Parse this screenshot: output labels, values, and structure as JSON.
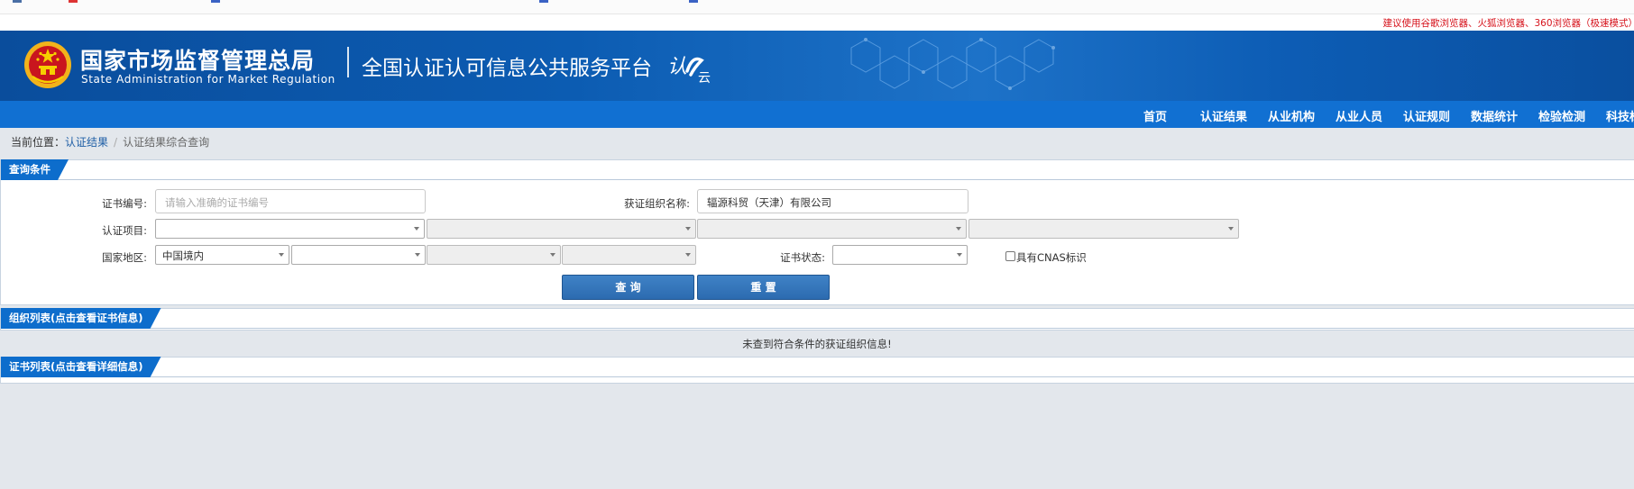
{
  "notice": {
    "text": "建议使用谷歌浏览器、火狐浏览器、360浏览器（极速模式）"
  },
  "header": {
    "org_cn": "国家市场监督管理总局",
    "org_en": "State Administration  for  Market Regulation",
    "platform_title": "全国认证认可信息公共服务平台",
    "logo_mark": "认证云",
    "emblem_icon": "national-emblem-icon"
  },
  "nav": {
    "items": [
      "首页",
      "认证结果",
      "从业机构",
      "从业人员",
      "认证规则",
      "数据统计",
      "检验检测",
      "科技标准"
    ]
  },
  "breadcrumb": {
    "prefix": "当前位置：",
    "link": "认证结果",
    "separator": "/",
    "current": "认证结果综合查询"
  },
  "query": {
    "tab_title": "查询条件",
    "cert_no": {
      "label": "证书编号:",
      "placeholder": "请输入准确的证书编号"
    },
    "org_name": {
      "label": "获证组织名称:",
      "value": "辐源科贸（天津）有限公司"
    },
    "cert_project": {
      "label": "认证项目:"
    },
    "region": {
      "label": "国家地区:",
      "selected": "中国境内"
    },
    "cert_status": {
      "label": "证书状态:"
    },
    "cnas": {
      "label": "具有CNAS标识"
    },
    "buttons": {
      "search": "查 询",
      "reset": "重 置"
    }
  },
  "org_list": {
    "tab_title": "组织列表(点击查看证书信息)",
    "empty_message": "未查到符合条件的获证组织信息!"
  },
  "cert_list": {
    "tab_title": "证书列表(点击查看详细信息)"
  }
}
